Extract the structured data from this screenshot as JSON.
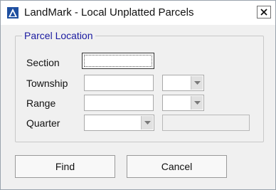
{
  "window": {
    "title": "LandMark - Local Unplatted Parcels",
    "app_icon": "landmark-app-icon",
    "close_icon": "close-icon"
  },
  "parcel_location": {
    "group_title": "Parcel Location",
    "section": {
      "label": "Section",
      "value": ""
    },
    "township": {
      "label": "Township",
      "value": "",
      "direction": ""
    },
    "range": {
      "label": "Range",
      "value": "",
      "direction": ""
    },
    "quarter": {
      "label": "Quarter",
      "selected": "",
      "description": ""
    }
  },
  "buttons": {
    "find": "Find",
    "cancel": "Cancel"
  },
  "colors": {
    "group_title": "#1a1aa0",
    "window_bg": "#f0f0f0"
  }
}
